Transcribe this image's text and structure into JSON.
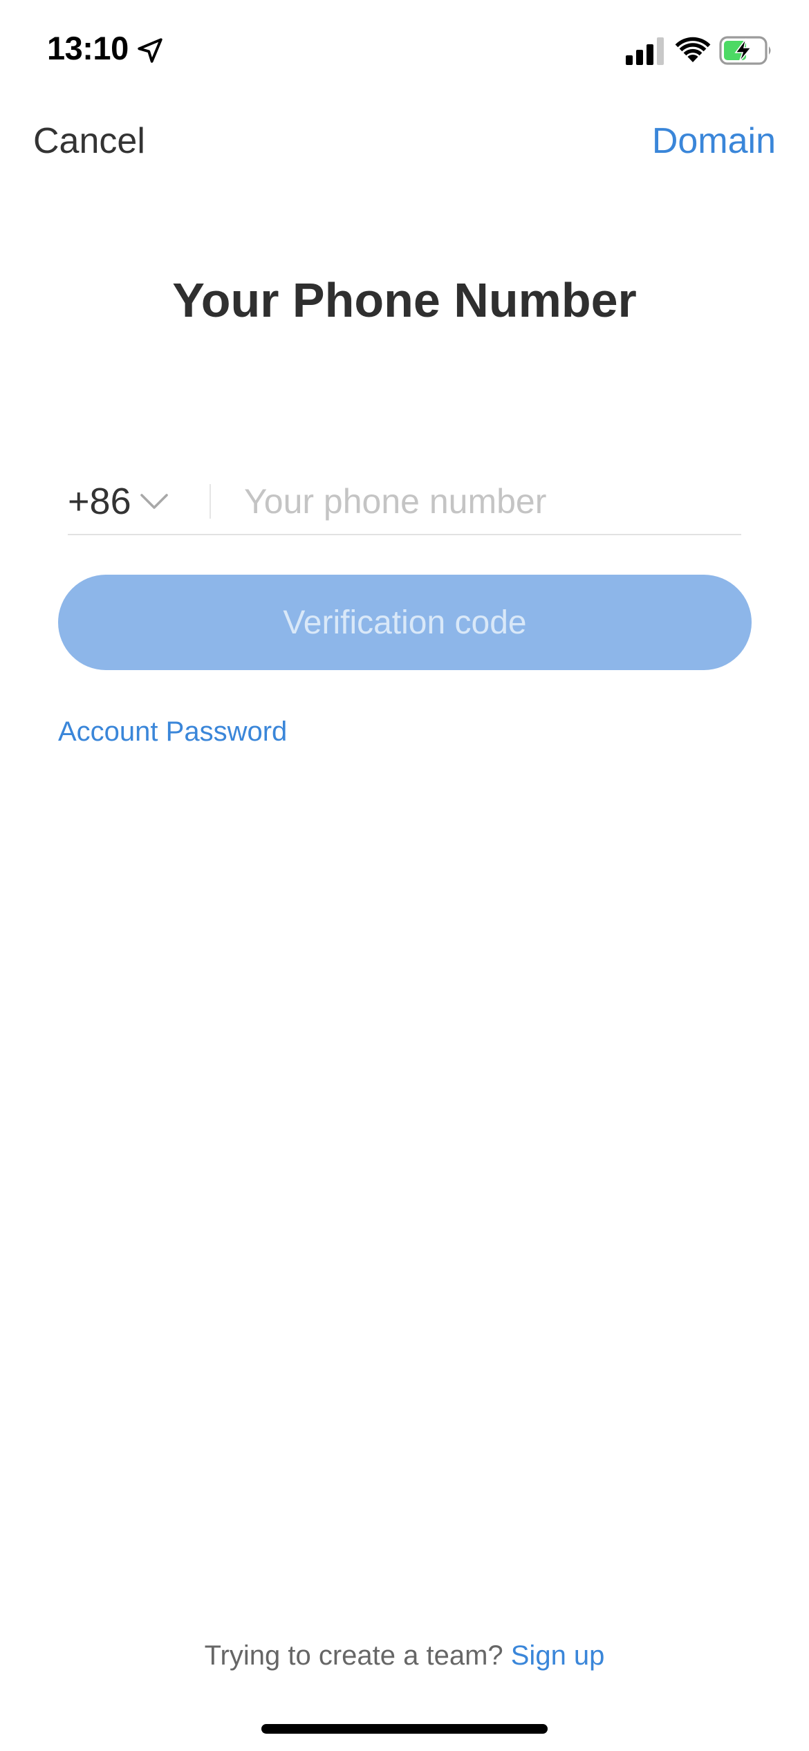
{
  "status_bar": {
    "time": "13:10",
    "icons": [
      "location-arrow-icon",
      "cellular-signal-icon",
      "wifi-icon",
      "battery-charging-icon"
    ],
    "battery_color": "#4cd964"
  },
  "nav": {
    "cancel_label": "Cancel",
    "domain_label": "Domain"
  },
  "title": "Your Phone Number",
  "phone": {
    "country_code": "+86",
    "placeholder": "Your phone number",
    "value": ""
  },
  "verify_button": {
    "label": "Verification code",
    "state": "disabled"
  },
  "account_password_label": "Account Password",
  "footer": {
    "prompt": "Trying to create a team?",
    "signup_label": "Sign up"
  },
  "colors": {
    "accent": "#3a86d9",
    "button_disabled": "#8db6e9",
    "text_primary": "#333333",
    "placeholder": "#c4c4c4"
  }
}
